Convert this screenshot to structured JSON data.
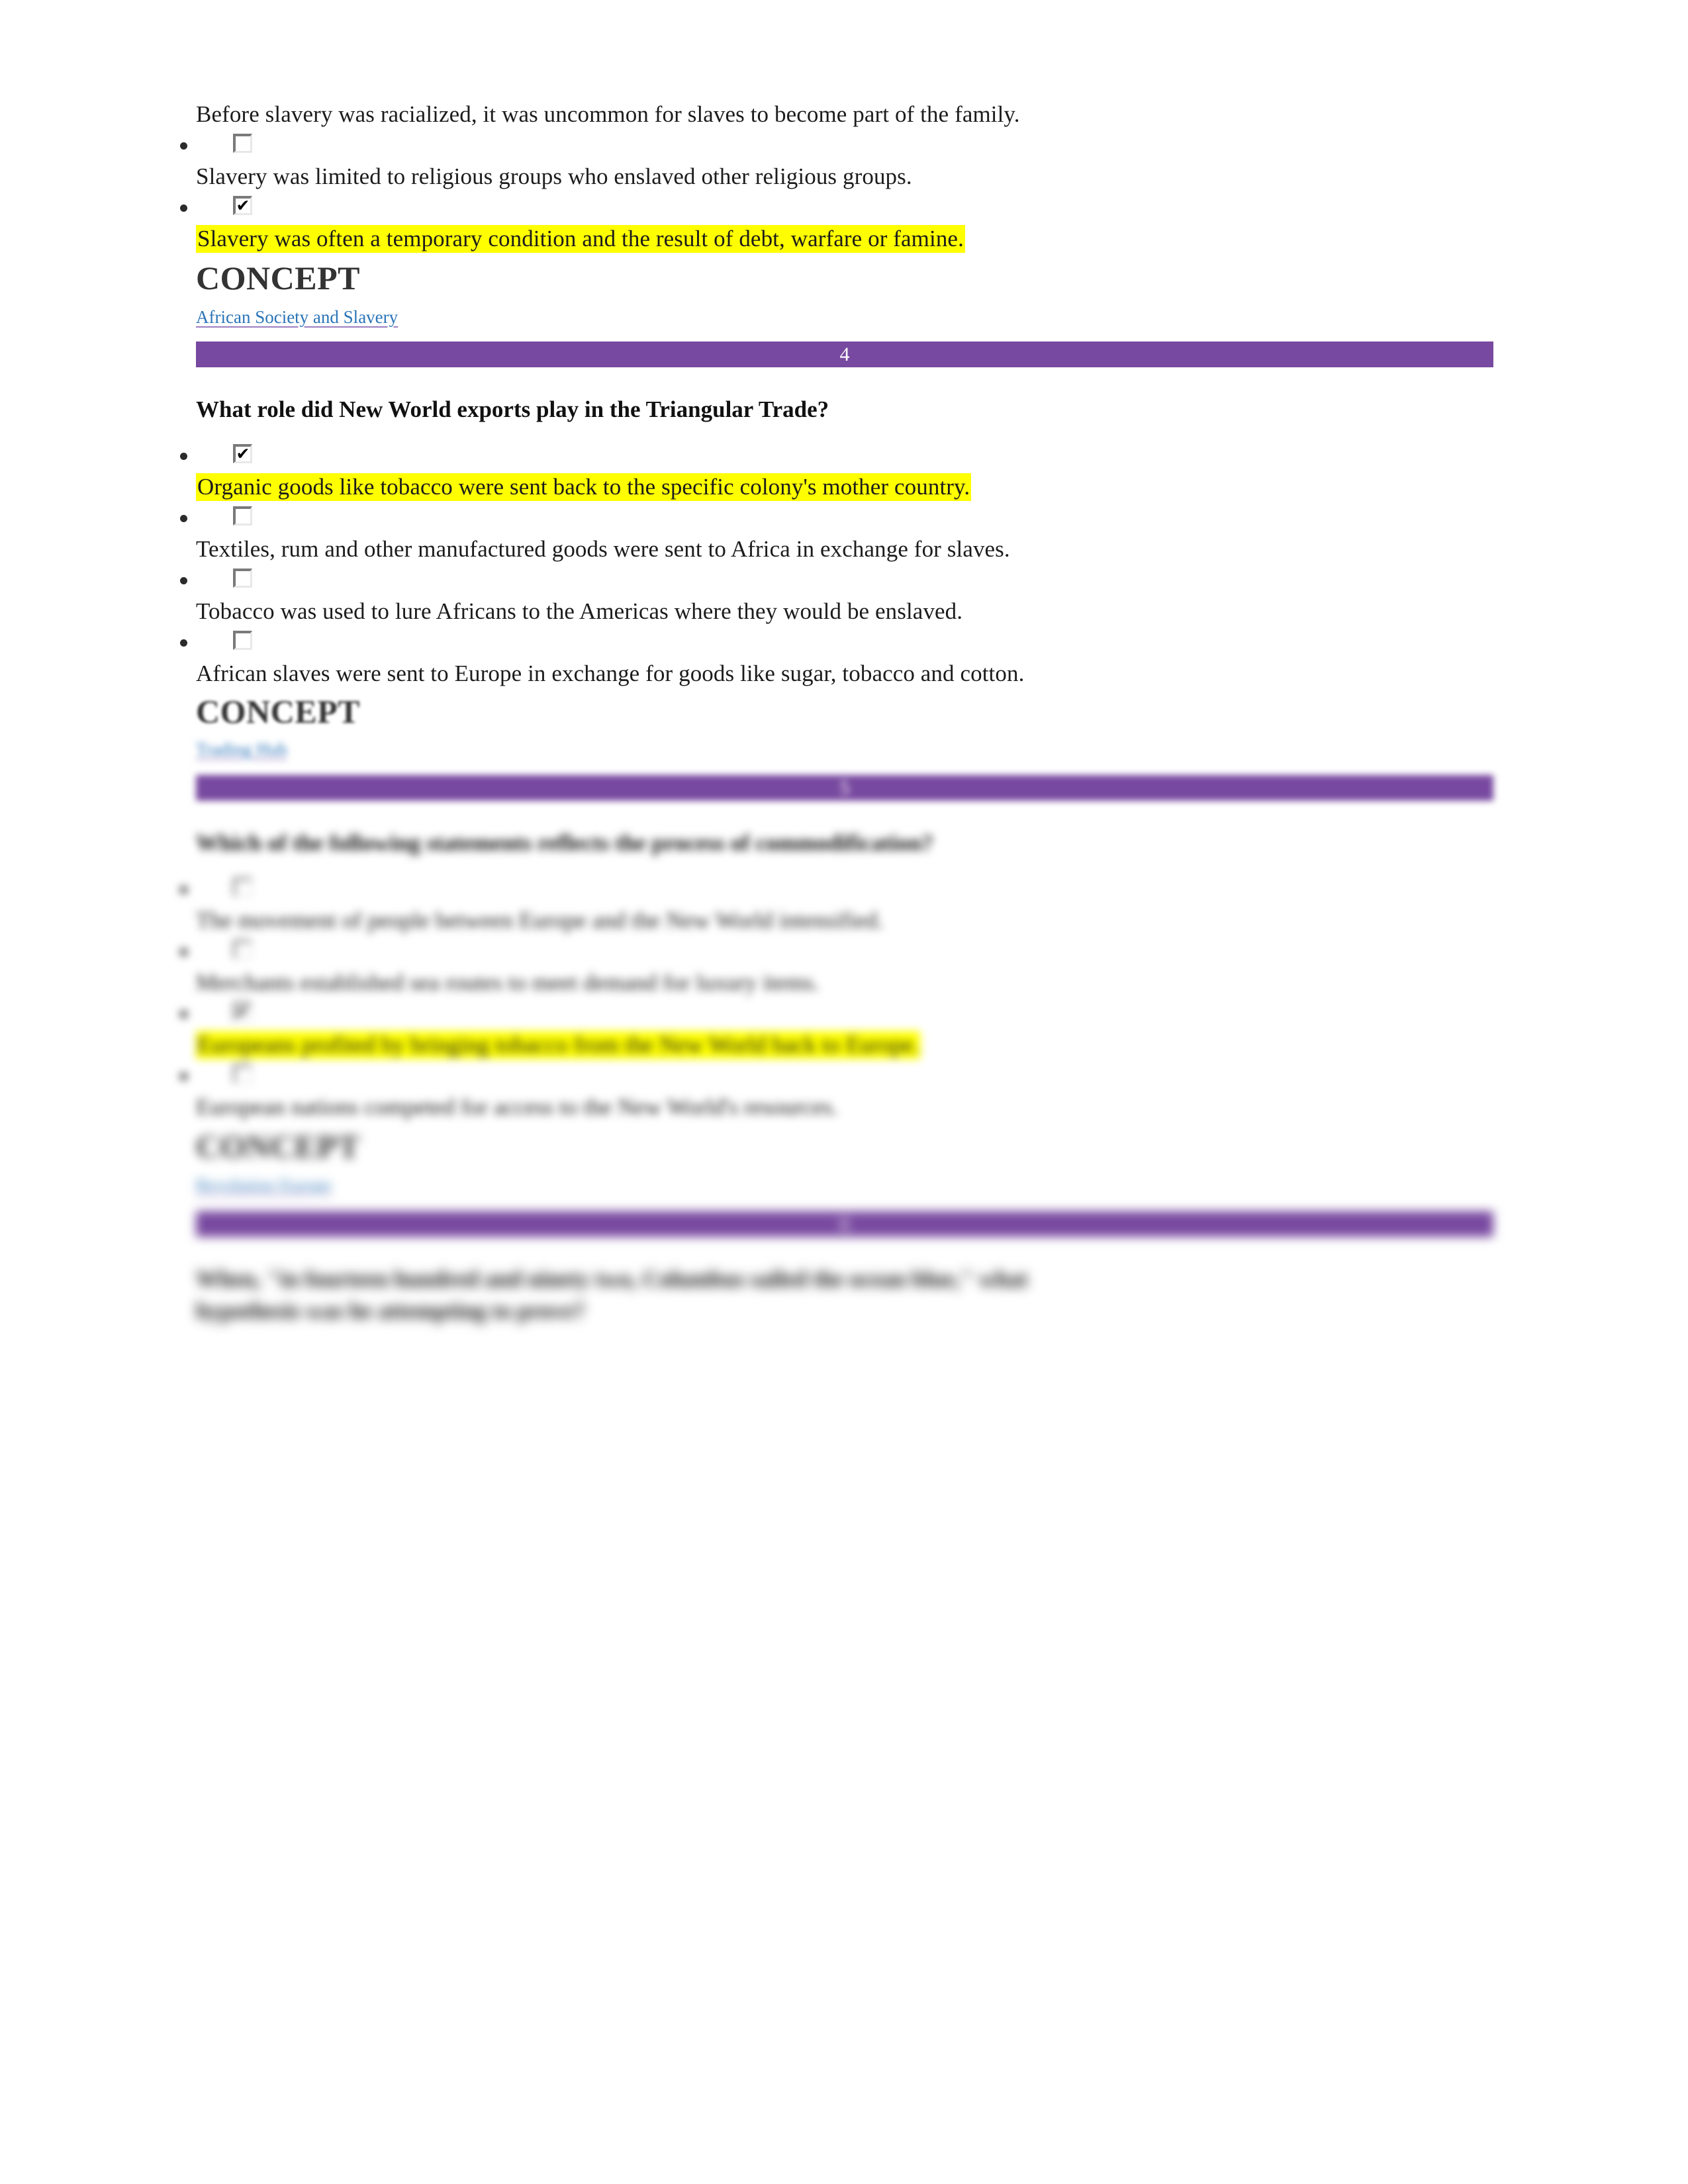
{
  "document": {
    "page_background": "#ffffff",
    "highlight_color": "#ffff00",
    "banner_color": "#7849a0",
    "link_color": "#2a74b8",
    "heading_color": "#333333"
  },
  "question_3_tail": {
    "options": [
      {
        "text": "Before slavery was racialized, it was uncommon for slaves to become part of the family.",
        "checked": false,
        "highlighted": false
      },
      {
        "text": "Slavery was limited to religious groups who enslaved other religious groups.",
        "checked": false,
        "highlighted": false
      },
      {
        "text": "Slavery was often a temporary condition and the result of debt, warfare or famine.",
        "checked": true,
        "highlighted": true
      }
    ],
    "concept_heading": "CONCEPT",
    "concept_link": "African Society and Slavery"
  },
  "question_4": {
    "banner_number": "4",
    "prompt": "What role did New World exports play in the Triangular Trade?",
    "options": [
      {
        "text": "Organic goods like tobacco were sent back to the specific colony's mother country.",
        "checked": true,
        "highlighted": true
      },
      {
        "text": "Textiles, rum and other manufactured goods were sent to Africa in exchange for slaves.",
        "checked": false,
        "highlighted": false
      },
      {
        "text": "Tobacco was used to lure Africans to the Americas where they would be enslaved.",
        "checked": false,
        "highlighted": false
      },
      {
        "text": "African slaves were sent to Europe in exchange for goods like sugar, tobacco and cotton.",
        "checked": false,
        "highlighted": false
      }
    ],
    "concept_heading": "CONCEPT",
    "concept_link": "Trading Hub"
  },
  "question_5": {
    "banner_number": "5",
    "prompt": "Which of the following statements reflects the process of commodification?",
    "options": [
      {
        "text": "The movement of people between Europe and the New World intensified.",
        "checked": false,
        "highlighted": false
      },
      {
        "text": "Merchants established sea routes to meet demand for luxury items.",
        "checked": false,
        "highlighted": false
      },
      {
        "text": "Europeans profited by bringing tobacco from the New World back to Europe.",
        "checked": true,
        "highlighted": true
      },
      {
        "text": "European nations competed for access to the New World's resources.",
        "checked": false,
        "highlighted": false
      }
    ],
    "concept_heading": "CONCEPT",
    "concept_link": "Revolution Europe"
  },
  "question_6": {
    "banner_number": "6",
    "prompt_line_1": "When, \"in fourteen hundred and ninety two, Columbus sailed the ocean blue,\" what",
    "prompt_line_2": "hypothesis was he attempting to prove?"
  },
  "icons": {
    "checked_glyph": "✔",
    "unchecked_glyph": " ",
    "bullet_glyph": "●"
  }
}
